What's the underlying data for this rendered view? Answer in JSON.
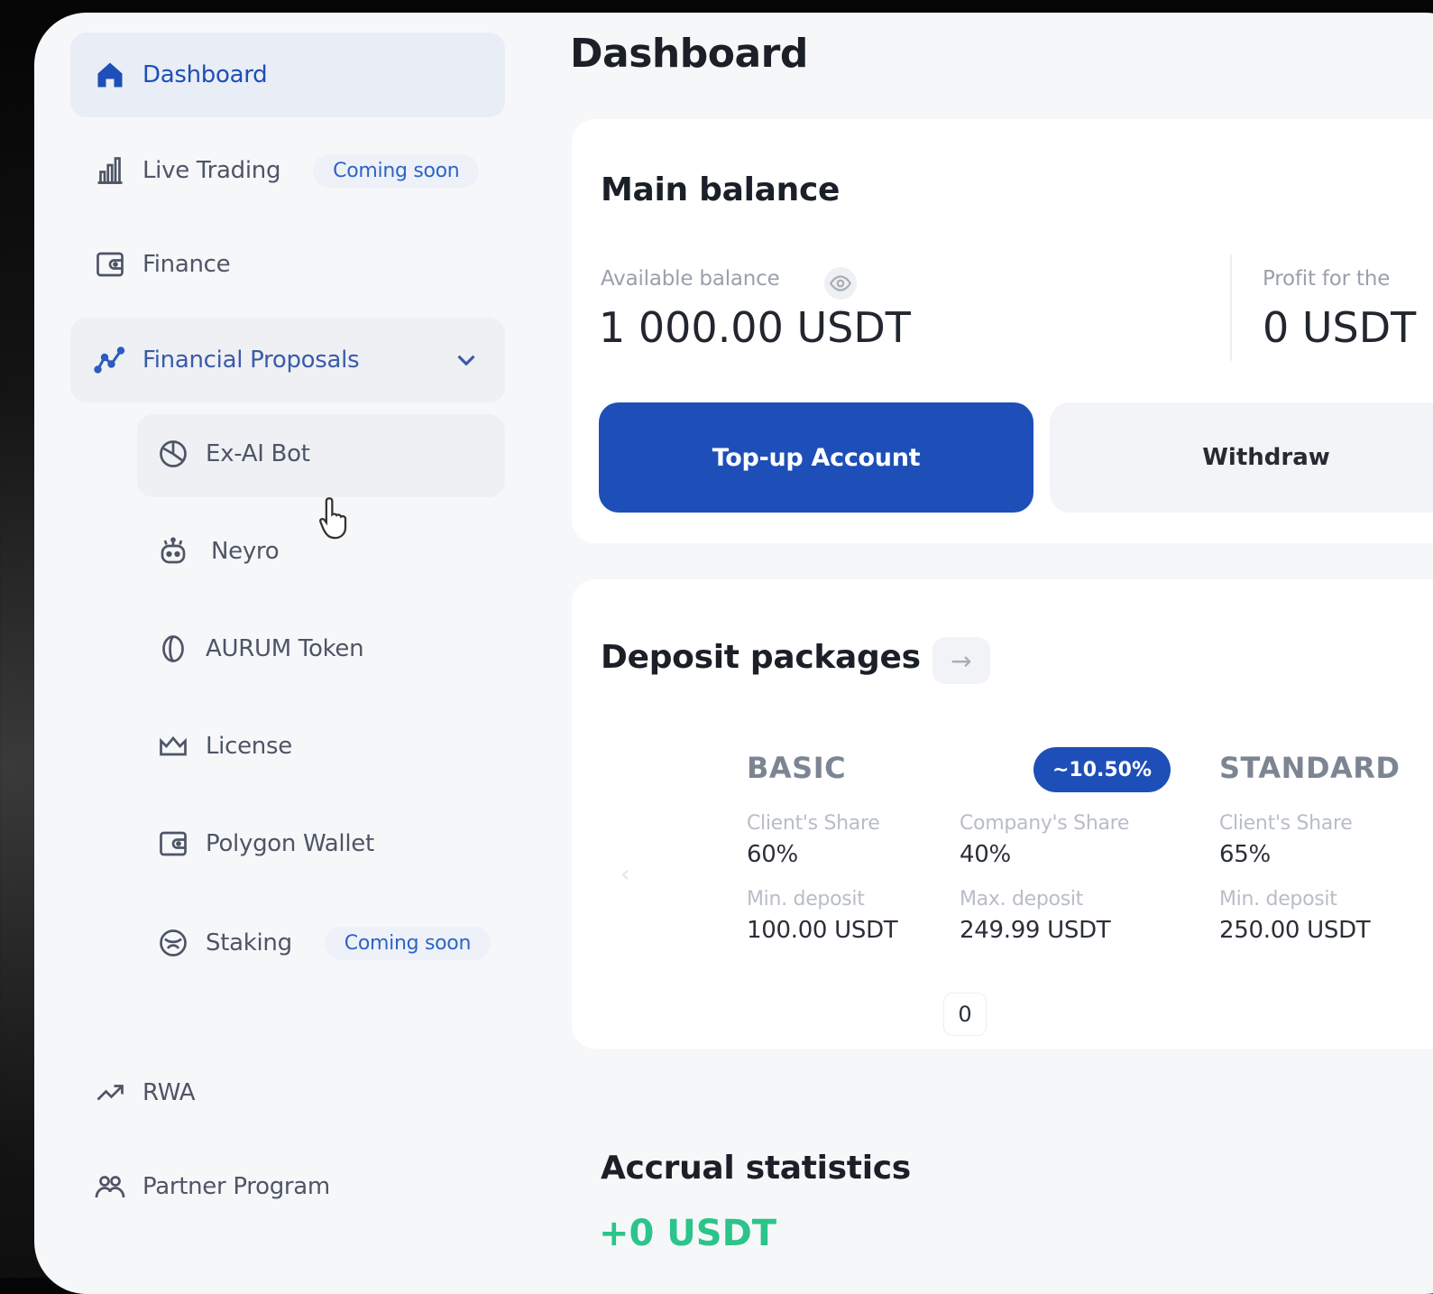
{
  "sidebar": {
    "dashboard": "Dashboard",
    "live_trading": "Live Trading",
    "live_trading_badge": "Coming soon",
    "finance": "Finance",
    "financial_proposals": "Financial Proposals",
    "sub_items": {
      "ex_ai_bot": "Ex-AI Bot",
      "neyro": "Neyro",
      "aurum_token": "AURUM Token",
      "license": "License",
      "polygon_wallet": "Polygon Wallet",
      "staking": "Staking",
      "staking_badge": "Coming soon"
    },
    "rwa": "RWA",
    "partner_program": "Partner Program"
  },
  "main": {
    "title": "Dashboard",
    "balance_card": {
      "title": "Main balance",
      "available_label": "Available balance",
      "available_value": "1 000.00 USDT",
      "profit_label": "Profit for the",
      "profit_value": "0 USDT",
      "topup_label": "Top-up Account",
      "withdraw_label": "Withdraw"
    },
    "deposit": {
      "title": "Deposit packages",
      "page_indicator": "0",
      "packages": [
        {
          "name": "BASIC",
          "badge": "~10.50%",
          "client_share_label": "Client's Share",
          "client_share": "60%",
          "company_share_label": "Company's Share",
          "company_share": "40%",
          "min_label": "Min. deposit",
          "min_value": "100.00 USDT",
          "max_label": "Max. deposit",
          "max_value": "249.99 USDT"
        },
        {
          "name": "STANDARD",
          "client_share_label": "Client's Share",
          "client_share": "65%",
          "min_label": "Min. deposit",
          "min_value": "250.00 USDT"
        }
      ]
    },
    "accrual": {
      "title": "Accrual statistics",
      "value": "+0 USDT"
    }
  },
  "colors": {
    "accent": "#1e4fb8",
    "positive": "#2bc48a",
    "muted_text": "#9aa0ab"
  }
}
